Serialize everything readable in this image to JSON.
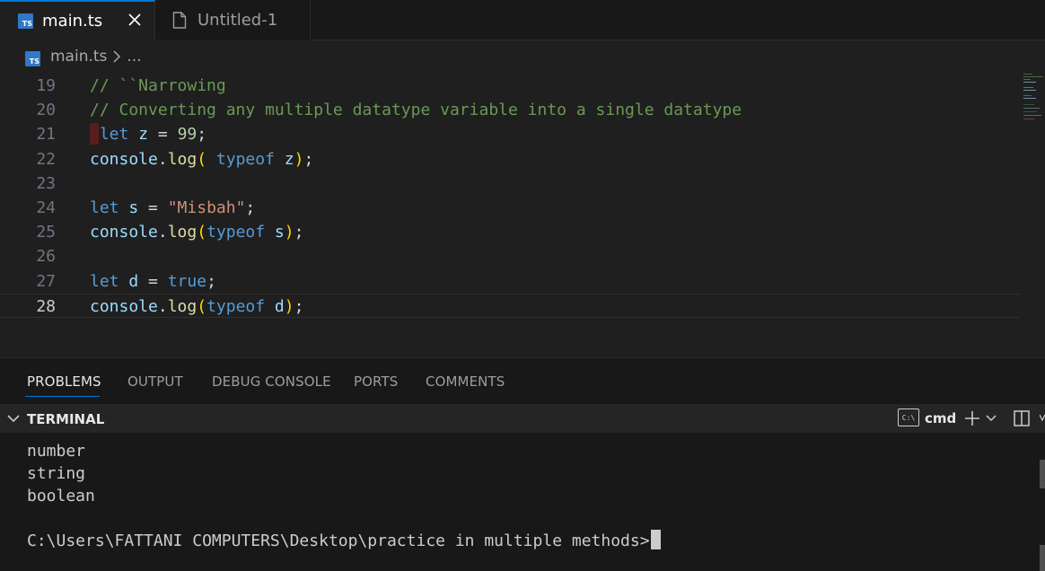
{
  "tabs": [
    {
      "label": "main.ts",
      "icon": "ts-icon",
      "active": true
    },
    {
      "label": "Untitled-1",
      "icon": "file-icon",
      "active": false
    }
  ],
  "ts_icon_text": "TS",
  "breadcrumb": {
    "file": "main.ts",
    "more": "..."
  },
  "editor": {
    "lines": [
      {
        "n": "19",
        "tokens": [
          {
            "t": "// ``Narrowing",
            "c": "cmt"
          }
        ]
      },
      {
        "n": "20",
        "tokens": [
          {
            "t": "// Converting any multiple datatype variable into a single datatype",
            "c": "cmt"
          }
        ]
      },
      {
        "n": "21",
        "tokens": [
          {
            "t": " let",
            "c": "kw"
          },
          {
            "t": " z ",
            "c": "var"
          },
          {
            "t": "= ",
            "c": "plain"
          },
          {
            "t": "99",
            "c": "num"
          },
          {
            "t": ";",
            "c": "plain"
          }
        ]
      },
      {
        "n": "22",
        "tokens": [
          {
            "t": "console",
            "c": "var"
          },
          {
            "t": ".",
            "c": "plain"
          },
          {
            "t": "log",
            "c": "fn"
          },
          {
            "t": "(",
            "c": "paren"
          },
          {
            "t": " typeof",
            "c": "kw"
          },
          {
            "t": " z",
            "c": "var"
          },
          {
            "t": ")",
            "c": "paren"
          },
          {
            "t": ";",
            "c": "plain"
          }
        ]
      },
      {
        "n": "23",
        "tokens": []
      },
      {
        "n": "24",
        "tokens": [
          {
            "t": "let",
            "c": "kw"
          },
          {
            "t": " s ",
            "c": "var"
          },
          {
            "t": "= ",
            "c": "plain"
          },
          {
            "t": "\"Misbah\"",
            "c": "str"
          },
          {
            "t": ";",
            "c": "plain"
          }
        ]
      },
      {
        "n": "25",
        "tokens": [
          {
            "t": "console",
            "c": "var"
          },
          {
            "t": ".",
            "c": "plain"
          },
          {
            "t": "log",
            "c": "fn"
          },
          {
            "t": "(",
            "c": "paren"
          },
          {
            "t": "typeof",
            "c": "kw"
          },
          {
            "t": " s",
            "c": "var"
          },
          {
            "t": ")",
            "c": "paren"
          },
          {
            "t": ";",
            "c": "plain"
          }
        ]
      },
      {
        "n": "26",
        "tokens": []
      },
      {
        "n": "27",
        "tokens": [
          {
            "t": "let",
            "c": "kw"
          },
          {
            "t": " d ",
            "c": "var"
          },
          {
            "t": "= ",
            "c": "plain"
          },
          {
            "t": "true",
            "c": "kw"
          },
          {
            "t": ";",
            "c": "plain"
          }
        ]
      },
      {
        "n": "28",
        "tokens": [
          {
            "t": "console",
            "c": "var"
          },
          {
            "t": ".",
            "c": "plain"
          },
          {
            "t": "log",
            "c": "fn"
          },
          {
            "t": "(",
            "c": "paren"
          },
          {
            "t": "typeof",
            "c": "kw"
          },
          {
            "t": " d",
            "c": "var"
          },
          {
            "t": ")",
            "c": "paren"
          },
          {
            "t": ";",
            "c": "plain"
          }
        ],
        "current": true
      }
    ]
  },
  "panel": {
    "tabs": [
      "PROBLEMS",
      "OUTPUT",
      "DEBUG CONSOLE",
      "PORTS",
      "COMMENTS"
    ],
    "active_tab": "PROBLEMS",
    "section_title": "TERMINAL",
    "shell_icon_text": "C:\\",
    "shell": "cmd"
  },
  "terminal": {
    "output": [
      "number",
      "string",
      "boolean"
    ],
    "prompt": "C:\\Users\\FATTANI COMPUTERS\\Desktop\\practice in multiple methods>"
  },
  "colors": {
    "accent": "#0078d4",
    "ts": "#3178c6",
    "comment": "#6a9955",
    "keyword": "#569cd6",
    "string": "#ce9178",
    "number": "#b5cea8"
  }
}
